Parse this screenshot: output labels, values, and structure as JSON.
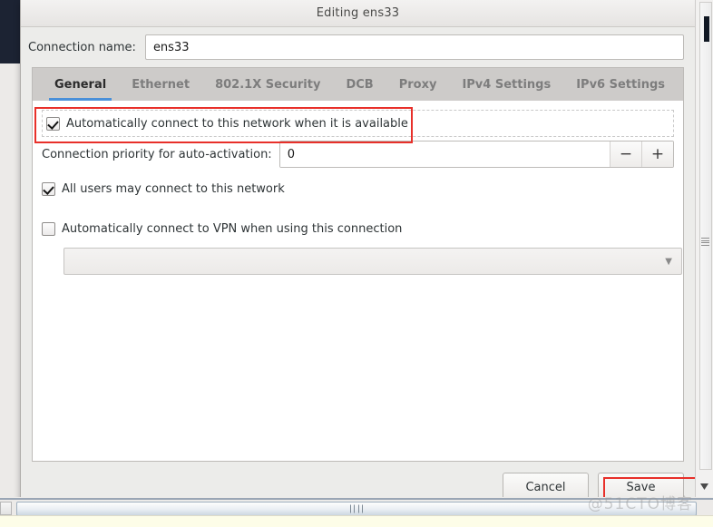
{
  "window": {
    "title": "Editing ens33"
  },
  "connection": {
    "name_label": "Connection name:",
    "name_value": "ens33"
  },
  "tabs": [
    {
      "label": "General",
      "active": true
    },
    {
      "label": "Ethernet",
      "active": false
    },
    {
      "label": "802.1X Security",
      "active": false
    },
    {
      "label": "DCB",
      "active": false
    },
    {
      "label": "Proxy",
      "active": false
    },
    {
      "label": "IPv4 Settings",
      "active": false
    },
    {
      "label": "IPv6 Settings",
      "active": false
    }
  ],
  "general": {
    "auto_connect": {
      "label": "Automatically connect to this network when it is available",
      "checked": true
    },
    "priority": {
      "label": "Connection priority for auto-activation:",
      "value": "0",
      "decrement": "−",
      "increment": "+"
    },
    "all_users": {
      "label": "All users may connect to this network",
      "checked": true
    },
    "auto_vpn": {
      "label": "Automatically connect to VPN when using this connection",
      "checked": false
    },
    "vpn_combo": {
      "selected": "",
      "arrow": "▼"
    }
  },
  "actions": {
    "cancel_label": "Cancel",
    "save_label": "Save"
  },
  "annotations": {
    "color": "#e8302a",
    "targets": [
      "auto-connect-checkbox-row",
      "save-button"
    ]
  },
  "watermark": {
    "text": "@51CTO博客"
  },
  "colors": {
    "accent": "#4a90d9",
    "dialog_bg": "#ececea",
    "tabbar_bg": "#cdcbc9",
    "page_bg": "#ffffff",
    "annotation": "#e8302a"
  },
  "scrollbars": {
    "vertical_arrow": "▼"
  }
}
